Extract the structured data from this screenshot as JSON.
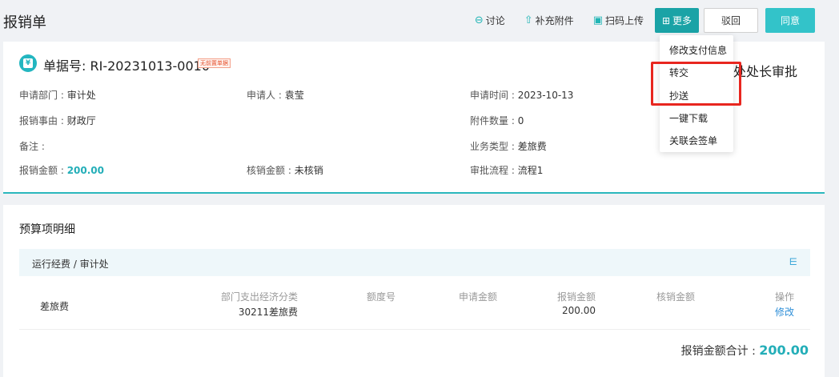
{
  "header": {
    "title": "报销单",
    "toolbar": {
      "discuss": "讨论",
      "attach": "补充附件",
      "scan": "扫码上传",
      "more": "更多",
      "reject": "驳回",
      "agree": "同意"
    }
  },
  "doc": {
    "number": "单据号: RI-20231013-0010",
    "tag": "无前置单据",
    "approval_stage": "处处长审批",
    "fields": {
      "dept_label": "申请部门 : ",
      "dept": "审计处",
      "applicant_label": "申请人 : ",
      "applicant": "袁莹",
      "time_label": "申请时间 : ",
      "time": "2023-10-13",
      "reason_label": "报销事由 : ",
      "reason": "财政厅",
      "attach_label": "附件数量 : ",
      "attach_count": "0",
      "remark_label": "备注 : ",
      "biz_label": "业务类型 : ",
      "biz_type": "差旅费",
      "amount_label": "报销金额 : ",
      "amount": "200.00",
      "verify_label": "核销金额 : ",
      "verify": "未核销",
      "flow_label": "审批流程 : ",
      "flow": "流程1"
    }
  },
  "detail": {
    "title": "预算项明细",
    "group_path": "运行经费 / 审计处",
    "row": {
      "name": "差旅费",
      "category_hd": "部门支出经济分类",
      "category": "30211差旅费",
      "quota_hd": "额度号",
      "apply_hd": "申请金额",
      "reimb_hd": "报销金额",
      "reimb": "200.00",
      "verify_hd": "核销金额",
      "op_hd": "操作",
      "op": "修改"
    },
    "total_label": "报销金额合计 : ",
    "total": "200.00"
  },
  "dropdown": {
    "items": [
      "修改支付信息",
      "转交",
      "抄送",
      "一键下载",
      "关联会签单"
    ]
  }
}
